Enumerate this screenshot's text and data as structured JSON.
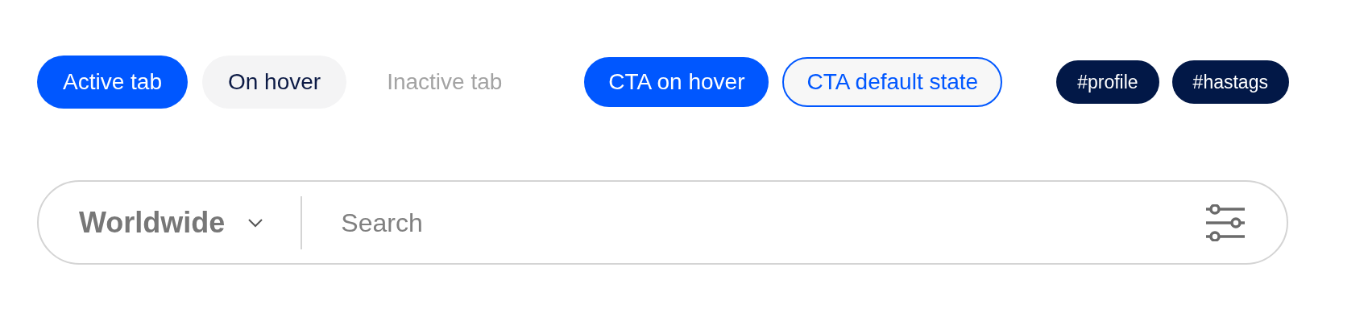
{
  "tabs": [
    {
      "label": "Active tab",
      "selected": true,
      "hovered": false
    },
    {
      "label": "On hover",
      "selected": false,
      "hovered": true
    },
    {
      "label": "Inactive tab",
      "selected": false,
      "hovered": false
    }
  ],
  "cta_buttons": [
    {
      "label": "CTA on hover",
      "kind": "filled"
    },
    {
      "label": "CTA default state",
      "kind": "outline"
    }
  ],
  "tags": [
    "#profile",
    "#hastags"
  ],
  "search_bar": {
    "region": "Worldwide",
    "placeholder": "Search"
  }
}
